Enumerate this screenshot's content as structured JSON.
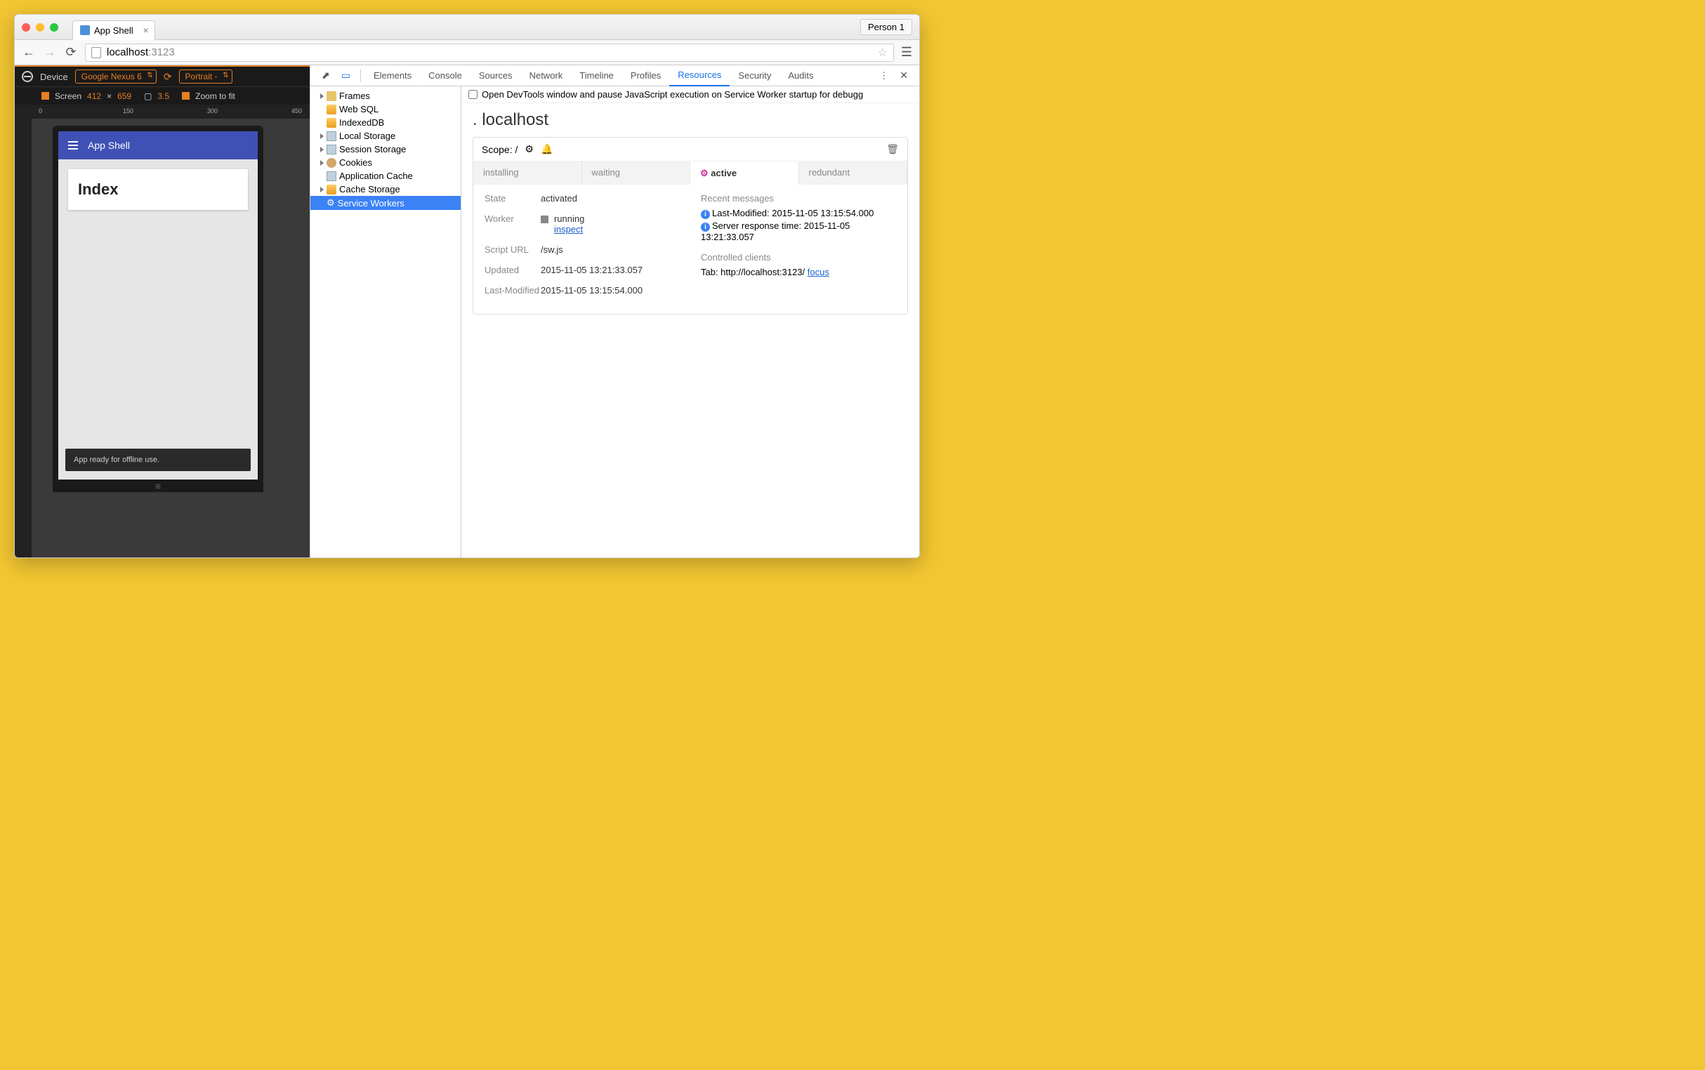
{
  "browser": {
    "tab_title": "App Shell",
    "person": "Person 1",
    "url_host": "localhost",
    "url_port": ":3123"
  },
  "device_mode": {
    "device_label": "Device",
    "device_name": "Google Nexus 6",
    "orientation": "Portrait - ",
    "screen_label": "Screen",
    "width": "412",
    "times": "×",
    "height": "659",
    "dpr": "3.5",
    "zoom_label": "Zoom to fit",
    "ruler_ticks": [
      "0",
      "150",
      "300",
      "450"
    ]
  },
  "app": {
    "title": "App Shell",
    "card_heading": "Index",
    "toast": "App ready for offline use."
  },
  "devtools": {
    "tabs": [
      "Elements",
      "Console",
      "Sources",
      "Network",
      "Timeline",
      "Profiles",
      "Resources",
      "Security",
      "Audits"
    ],
    "active_tab": "Resources",
    "resources_tree": [
      {
        "label": "Frames",
        "icon": "folder",
        "expand": true
      },
      {
        "label": "Web SQL",
        "icon": "db"
      },
      {
        "label": "IndexedDB",
        "icon": "db"
      },
      {
        "label": "Local Storage",
        "icon": "storage",
        "expand": true
      },
      {
        "label": "Session Storage",
        "icon": "storage",
        "expand": true
      },
      {
        "label": "Cookies",
        "icon": "cookie",
        "expand": true
      },
      {
        "label": "Application Cache",
        "icon": "storage"
      },
      {
        "label": "Cache Storage",
        "icon": "db",
        "expand": true
      },
      {
        "label": "Service Workers",
        "icon": "gear",
        "selected": true
      }
    ],
    "banner": "Open DevTools window and pause JavaScript execution on Service Worker startup for debugg",
    "sw": {
      "host": "localhost",
      "scope_label": "Scope: /",
      "tabs": [
        "installing",
        "waiting",
        "active",
        "redundant"
      ],
      "active_tab": "active",
      "state_label": "State",
      "state_value": "activated",
      "worker_label": "Worker",
      "worker_status": "running",
      "worker_inspect": "inspect",
      "script_label": "Script URL",
      "script_value": "/sw.js",
      "updated_label": "Updated",
      "updated_value": "2015-11-05 13:21:33.057",
      "modified_label": "Last-Modified",
      "modified_value": "2015-11-05 13:15:54.000",
      "recent_title": "Recent messages",
      "msg1": "Last-Modified: 2015-11-05 13:15:54.000",
      "msg2": "Server response time: 2015-11-05 13:21:33.057",
      "clients_title": "Controlled clients",
      "client_text": "Tab: http://localhost:3123/ ",
      "client_focus": "focus"
    }
  }
}
